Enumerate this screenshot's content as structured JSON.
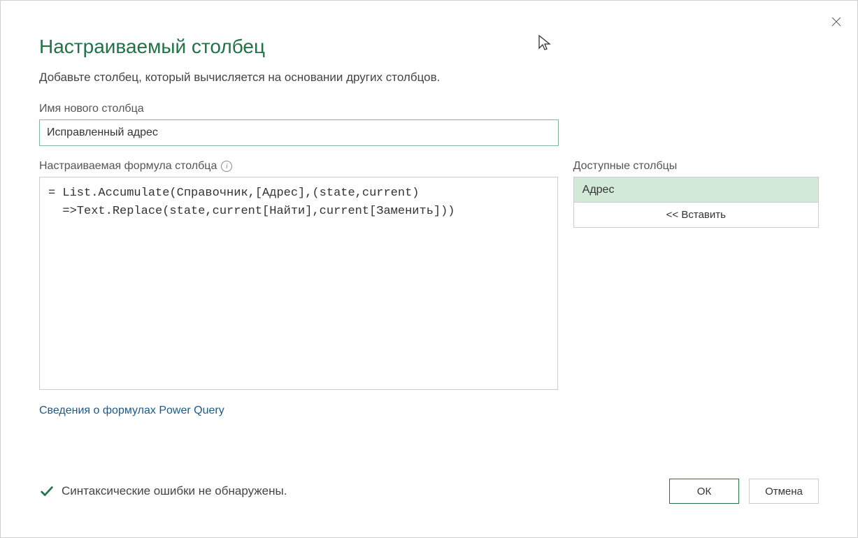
{
  "dialog": {
    "title": "Настраиваемый столбец",
    "subtitle": "Добавьте столбец, который вычисляется на основании других столбцов."
  },
  "name_section": {
    "label": "Имя нового столбца",
    "value": "Исправленный адрес"
  },
  "formula_section": {
    "label": "Настраиваемая формула столбца",
    "value": "= List.Accumulate(Справочник,[Адрес],(state,current)\n  =>Text.Replace(state,current[Найти],current[Заменить]))"
  },
  "available_columns": {
    "label": "Доступные столбцы",
    "items": [
      "Адрес"
    ],
    "insert_label": "<< Вставить"
  },
  "formula_link": "Сведения о формулах Power Query",
  "status": {
    "text": "Синтаксические ошибки не обнаружены."
  },
  "buttons": {
    "ok": "ОК",
    "cancel": "Отмена"
  }
}
